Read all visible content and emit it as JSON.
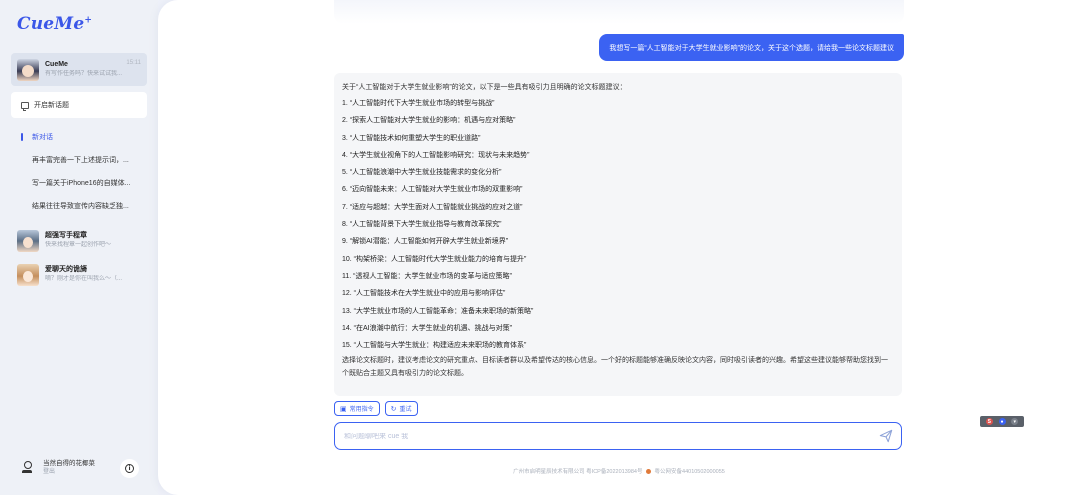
{
  "app": {
    "logo": "CueMe",
    "logo_mark": "+"
  },
  "contacts": [
    {
      "name": "CueMe",
      "sub": "有写作任务吗？快来试试我...",
      "time": "15:11",
      "avatar": "cueme-avatar"
    },
    {
      "name": "超强写手程章",
      "sub": "快来找程章一起创作吧～",
      "avatar": "writer-avatar"
    },
    {
      "name": "爱聊天的诡旖",
      "sub": "嘀？刚才是你在叫我么～（...",
      "avatar": "chatter-avatar"
    }
  ],
  "sidebar": {
    "new_topic_label": "开启新话题",
    "history": [
      "新对话",
      "再丰富完善一下上述提示词，...",
      "写一篇关于iPhone16的自媒体...",
      "结果往往导致宣传内容缺乏独..."
    ],
    "user": {
      "name": "当然自得的花椰菜",
      "logout": "登出",
      "info_icon": "info-circle-icon"
    }
  },
  "chat": {
    "user_message": "我想写一篇“人工智能对于大学生就业影响”的论文，关于这个选题，请给我一些论文标题建议",
    "reply_intro": "关于“人工智能对于大学生就业影响”的论文，以下是一些具有吸引力且明确的论文标题建议：",
    "titles": [
      "1. “人工智能时代下大学生就业市场的转型与挑战”",
      "2. “探索人工智能对大学生就业的影响：机遇与应对策略”",
      "3. “人工智能技术如何重塑大学生的职业道路”",
      "4. “大学生就业视角下的人工智能影响研究：现状与未来趋势”",
      "5. “人工智能浪潮中大学生就业技能需求的变化分析”",
      "6. “迈向智能未来：人工智能对大学生就业市场的双重影响”",
      "7. “适应与超越：大学生面对人工智能就业挑战的应对之道”",
      "8. “人工智能背景下大学生就业指导与教育改革探究”",
      "9. “解锁AI潜能：人工智能如何开辟大学生就业新境界”",
      "10. “构架桥梁：人工智能时代大学生就业能力的培育与提升”",
      "11. “透视人工智能：大学生就业市场的变革与适应策略”",
      "12. “人工智能技术在大学生就业中的应用与影响评估”",
      "13. “大学生就业市场的人工智能革命：准备未来职场的新策略”",
      "14. “在AI浪潮中航行：大学生就业的机遇、挑战与对策”",
      "15. “人工智能与大学生就业：构建适应未来职场的教育体系”"
    ],
    "reply_footer": "选择论文标题时，建议考虑论文的研究重点、目标读者群以及希望传达的核心信息。一个好的标题能够准确反映论文内容，同时吸引读者的兴趣。希望这些建议能够帮助您找到一个既贴合主题又具有吸引力的论文标题。"
  },
  "toolbar": {
    "common_commands_label": "常用指令",
    "retry_label": "重试"
  },
  "input": {
    "placeholder": "和问题聊吧来 cue 我"
  },
  "footer": {
    "company": "广州市启明星辰技术有限公司 粤ICP备2022013984号",
    "police": "粤公网安备44010502000055"
  },
  "colors": {
    "accent": "#3b62f2",
    "sidebar_bg": "#eef1f7",
    "reply_bg": "#f5f6f8"
  }
}
